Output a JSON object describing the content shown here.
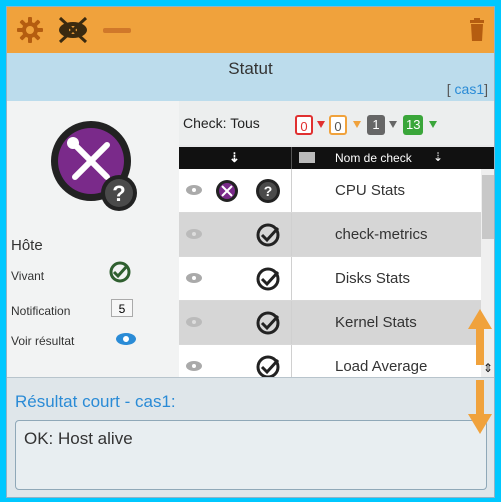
{
  "toolbar": {
    "icons": [
      "gear-icon",
      "eye-slash-icon",
      "minus-icon",
      "trash-icon"
    ]
  },
  "header": {
    "title": "Statut",
    "host_prefix": "[ ",
    "host": "cas1",
    "host_suffix": "]"
  },
  "host_panel": {
    "section_label": "Hôte",
    "alive_label": "Vivant",
    "notification_label": "Notification",
    "notification_value": "5",
    "view_result_label": "Voir résultat"
  },
  "filter": {
    "label": "Check: Tous",
    "counts": {
      "critical": "0",
      "warning": "0",
      "unknown": "1",
      "ok": "13"
    }
  },
  "table": {
    "header_name": "Nom de check",
    "rows": [
      {
        "name": "CPU Stats",
        "status": "unknown"
      },
      {
        "name": "check-metrics",
        "status": "ok"
      },
      {
        "name": "Disks Stats",
        "status": "ok"
      },
      {
        "name": "Kernel Stats",
        "status": "ok"
      },
      {
        "name": "Load Average",
        "status": "ok"
      }
    ]
  },
  "output": {
    "heading": "Résultat court - cas1:",
    "text": "OK: Host alive"
  },
  "colors": {
    "toolbar": "#f0a23c",
    "header": "#bcdcec",
    "accent": "#2a8bd6",
    "ok": "#2f7f2f",
    "critical": "#e03030",
    "warning": "#f0a23c"
  }
}
